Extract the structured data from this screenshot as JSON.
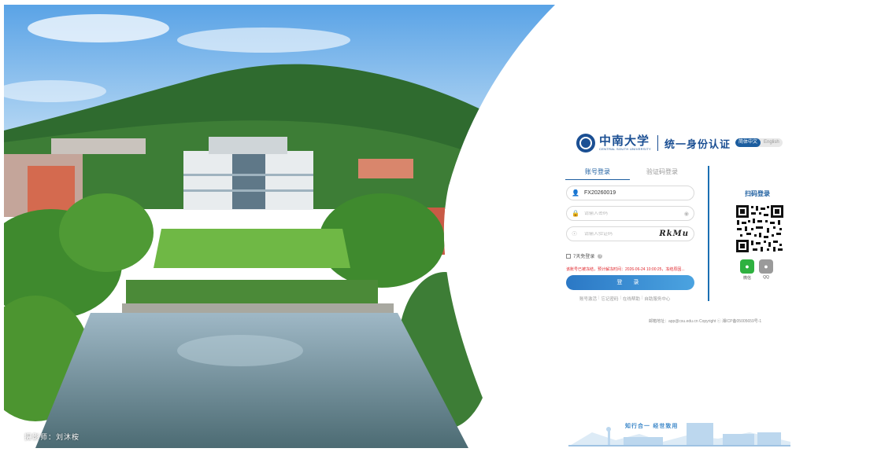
{
  "photo": {
    "credit": "摄影师：刘沐桉"
  },
  "brand": {
    "name_cn": "中南大学",
    "name_en": "CENTRAL SOUTH UNIVERSITY",
    "system_title": "统一身份认证"
  },
  "language": {
    "zh": "简体中文",
    "en": "English"
  },
  "tabs": [
    {
      "label": "账号登录",
      "active": true
    },
    {
      "label": "验证码登录",
      "active": false
    }
  ],
  "form": {
    "username_value": "FX20260019",
    "password_placeholder": "请输入密码",
    "captcha_placeholder": "请输入验证码",
    "captcha_text": "RkMu",
    "remember_label": "7天免登录",
    "warning": "该账号已被冻结，预计解冻时间：2026-06-24 10:00:25，冻结原因...",
    "login_button": "登 录"
  },
  "links": [
    "账号激活",
    "忘记密码",
    "在线帮助",
    "自助服务中心"
  ],
  "qr": {
    "title": "扫码登录",
    "options": [
      {
        "label": "微信",
        "icon": "wechat-icon"
      },
      {
        "label": "QQ",
        "icon": "qq-icon"
      }
    ]
  },
  "footer": "邮箱地址：app@csu.edu.cn Copyright ⓒ 湘ICP备05005659号-1",
  "motto": "知行合一  经世致用",
  "colors": {
    "brand": "#1b4f93",
    "accent": "#1b6fb3",
    "warning": "#e0282e",
    "wechat": "#2fb140"
  }
}
